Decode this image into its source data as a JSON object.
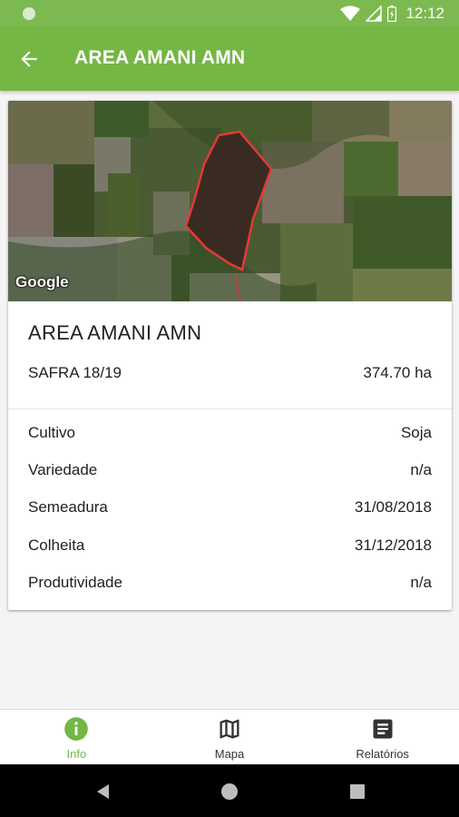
{
  "status_bar": {
    "time": "12:12"
  },
  "app_bar": {
    "title": "AREA AMANI AMN"
  },
  "map": {
    "attribution": "Google",
    "boundary_color": "#e53935"
  },
  "field": {
    "name": "AREA AMANI AMN",
    "season": "SAFRA 18/19",
    "area": "374.70 ha"
  },
  "details": [
    {
      "label": "Cultivo",
      "value": "Soja"
    },
    {
      "label": "Variedade",
      "value": "n/a"
    },
    {
      "label": "Semeadura",
      "value": "31/08/2018"
    },
    {
      "label": "Colheita",
      "value": "31/12/2018"
    },
    {
      "label": "Produtividade",
      "value": "n/a"
    }
  ],
  "bottom_nav": {
    "items": [
      {
        "label": "Info",
        "icon": "info-icon",
        "active": true
      },
      {
        "label": "Mapa",
        "icon": "map-icon",
        "active": false
      },
      {
        "label": "Relatórios",
        "icon": "report-icon",
        "active": false
      }
    ]
  },
  "colors": {
    "primary": "#74b744",
    "status_bar": "#7cb950",
    "active_nav": "#74b744"
  }
}
